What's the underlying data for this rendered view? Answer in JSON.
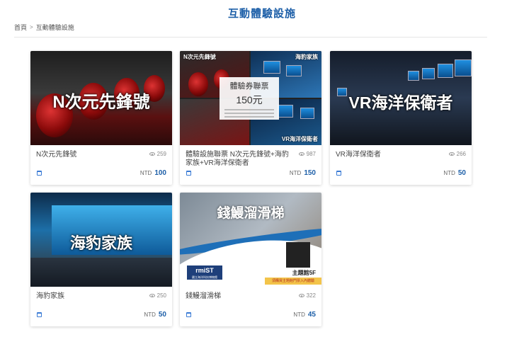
{
  "page": {
    "title": "互動體驗設施"
  },
  "breadcrumb": {
    "home": "首頁",
    "separator": ">",
    "current": "互動體驗設施"
  },
  "colors": {
    "accent": "#1d5fa8",
    "text": "#444444",
    "muted": "#888888"
  },
  "cards": [
    {
      "name": "N次元先鋒號",
      "views": "259",
      "currency": "NTD",
      "price": "100",
      "overlay": "N次元先鋒號"
    },
    {
      "name": "體驗設施聯票 N次元先鋒號+海豹家族+VR海洋保衛者",
      "views": "987",
      "currency": "NTD",
      "price": "150",
      "labels": {
        "tl": "N次元先鋒號",
        "tr": "海豹家族",
        "br": "VR海洋保衛者"
      },
      "ticket": {
        "line1": "體驗券聯票",
        "line2": "150元"
      }
    },
    {
      "name": "VR海洋保衛者",
      "views": "266",
      "currency": "NTD",
      "price": "50",
      "overlay": "VR海洋保衛者"
    },
    {
      "name": "海豹家族",
      "views": "250",
      "currency": "NTD",
      "price": "50",
      "overlay": "海豹家族"
    },
    {
      "name": "錢鰻溜滑梯",
      "views": "322",
      "currency": "NTD",
      "price": "45",
      "overlay": "錢鰻溜滑梯",
      "logo": {
        "text": "rmiST",
        "sub": "國立海洋科技博物館"
      },
      "floor": "主題館5F",
      "notice": "須購買主題館門票入內體驗"
    }
  ],
  "icons": {
    "views": "eye-icon",
    "date": "calendar-icon"
  }
}
